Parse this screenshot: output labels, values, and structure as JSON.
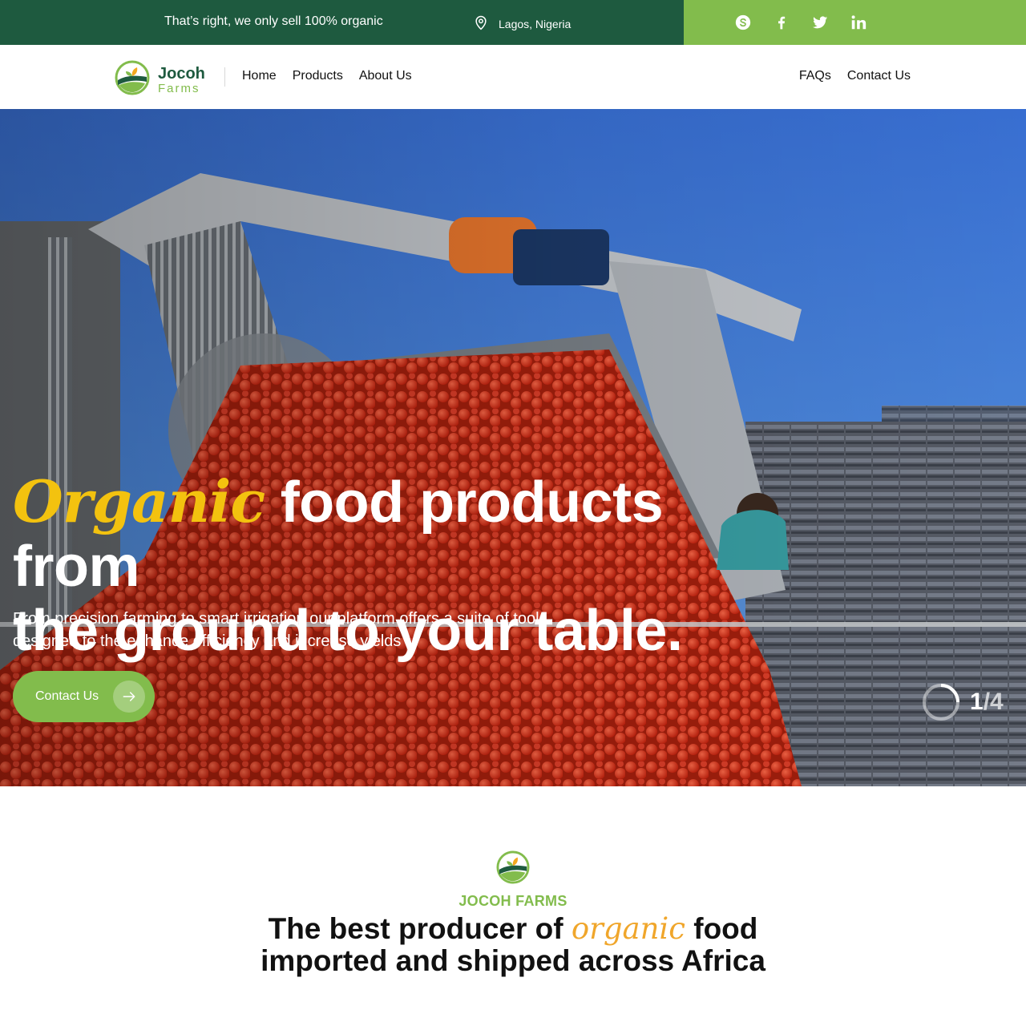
{
  "topbar": {
    "tagline": "That’s right, we only sell 100% organic",
    "location": "Lagos, Nigeria",
    "social": [
      "skype-icon",
      "facebook-icon",
      "twitter-icon",
      "linkedin-icon"
    ]
  },
  "brand": {
    "name": "Jocoh",
    "sub": "Farms"
  },
  "nav": {
    "home": "Home",
    "products": "Products",
    "about": "About Us",
    "faqs": "FAQs",
    "contact": "Contact Us"
  },
  "hero": {
    "title_accent": "Organic",
    "title_rest_line1": " food products from",
    "title_line2": "the ground to your table.",
    "subtitle": "From precision farming to smart irrigation our platform offers a suite of tools designed to the enhance efficiency and increase yields",
    "cta_label": "Contact Us",
    "slide_current": "1",
    "slide_sep": "/",
    "slide_total": "4"
  },
  "intro": {
    "eyebrow": "JOCOH FARMS",
    "heading_pre": "The best producer of ",
    "heading_accent": "organic",
    "heading_post_line1": " food",
    "heading_line2": "imported and shipped across Africa"
  },
  "colors": {
    "topbar_dark": "#1e5a3f",
    "brand_green": "#82bc4c",
    "hero_accent": "#f3c20f",
    "intro_accent": "#f0a62b"
  }
}
